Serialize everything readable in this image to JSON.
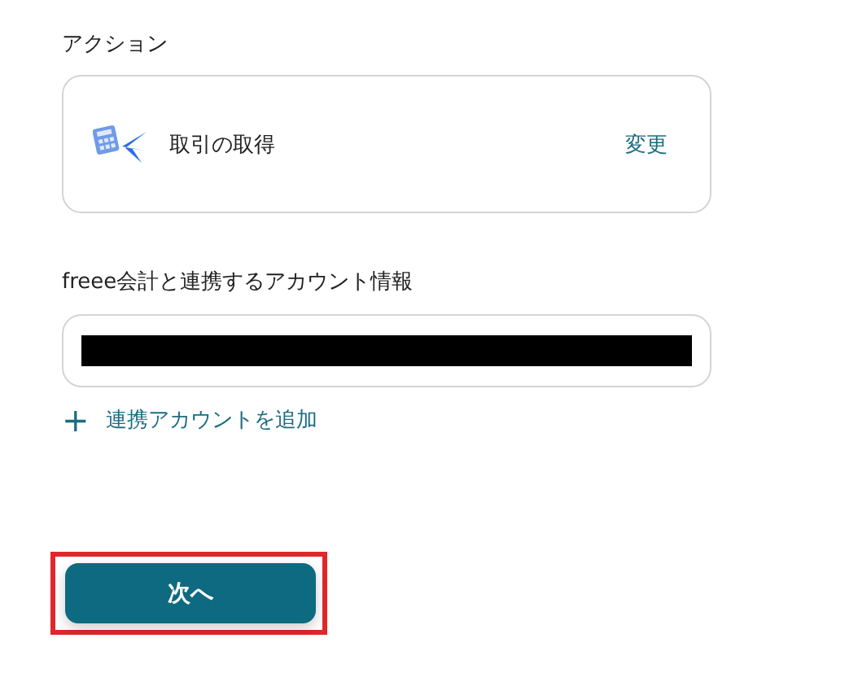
{
  "action_section": {
    "label": "アクション",
    "action_name": "取引の取得",
    "change_link": "変更"
  },
  "account_section": {
    "label": "freee会計と連携するアカウント情報",
    "account_field": {
      "redacted": true
    },
    "add_link": {
      "icon": "+",
      "label": "連携アカウントを追加"
    }
  },
  "next_button": {
    "label": "次へ",
    "highlighted": true
  }
}
